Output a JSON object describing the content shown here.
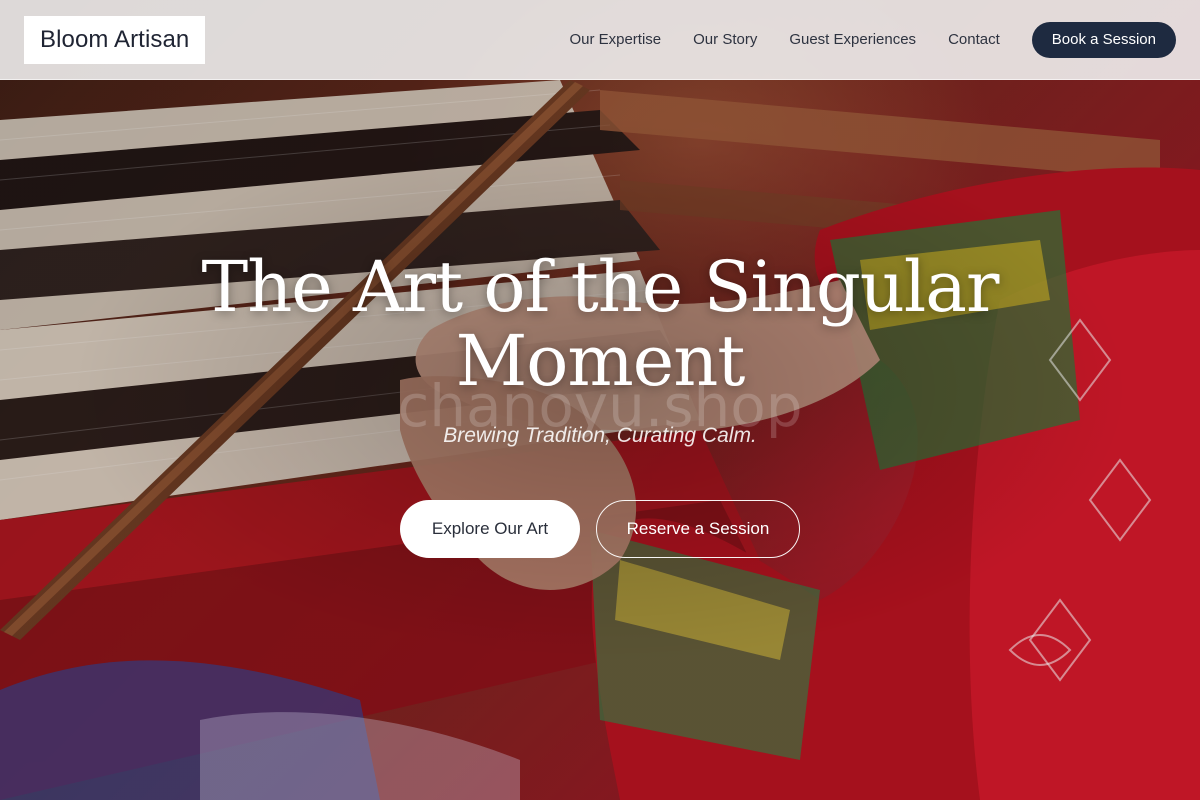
{
  "brand": {
    "name": "Bloom Artisan"
  },
  "nav": {
    "links": [
      "Our Expertise",
      "Our Story",
      "Guest Experiences",
      "Contact"
    ],
    "cta_label": "Book a Session"
  },
  "hero": {
    "title": "The Art of the Singular Moment",
    "subtitle": "Brewing Tradition, Curating Calm.",
    "watermark": "chanoyu.shop",
    "primary_button": "Explore Our Art",
    "secondary_button": "Reserve a Session"
  },
  "colors": {
    "header_bg": "#f0eeee",
    "brand_text": "#1f2433",
    "cta_bg": "#1e2a40",
    "hero_text": "#ffffff",
    "textile_red": "#c8102e"
  }
}
